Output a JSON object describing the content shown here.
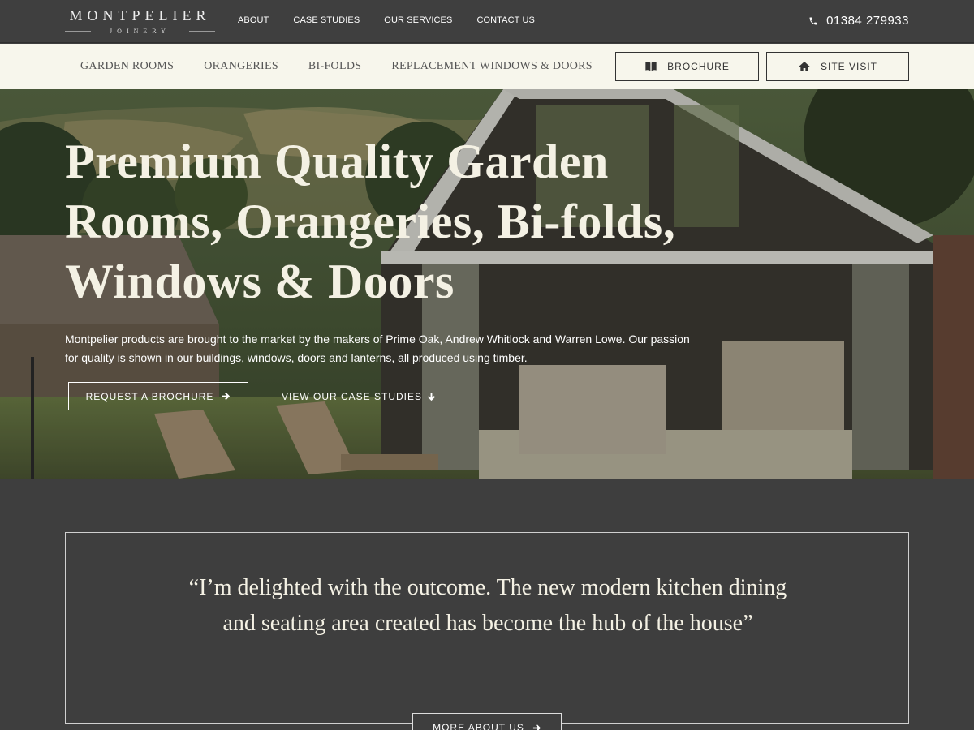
{
  "brand": {
    "name": "MONTPELIER",
    "sub": "JOINERY"
  },
  "topnav": {
    "items": [
      {
        "label": "ABOUT"
      },
      {
        "label": "CASE STUDIES"
      },
      {
        "label": "OUR SERVICES"
      },
      {
        "label": "CONTACT US"
      }
    ],
    "phone": "01384 279933",
    "phone_icon": "phone-icon"
  },
  "subnav": {
    "items": [
      {
        "label": "GARDEN ROOMS"
      },
      {
        "label": "ORANGERIES"
      },
      {
        "label": "BI-FOLDS"
      },
      {
        "label": "REPLACEMENT WINDOWS & DOORS"
      }
    ],
    "brochure_label": "BROCHURE",
    "brochure_icon": "book-icon",
    "visit_label": "SITE VISIT",
    "visit_icon": "home-icon"
  },
  "hero": {
    "title": "Premium Quality Garden Rooms, Orangeries, Bi-folds, Windows & Doors",
    "text": "Montpelier products are brought to the market by the makers of Prime Oak, Andrew Whitlock and Warren Lowe. Our passion for quality is shown in our buildings, windows, doors and lanterns, all produced using timber.",
    "cta_primary": "REQUEST A BROCHURE",
    "cta_secondary": "VIEW OUR CASE STUDIES"
  },
  "testimonial": {
    "quote": "“I’m delighted with the outcome. The new modern kitchen dining and seating area created has become the hub of the house”",
    "button": "MORE ABOUT US"
  },
  "colors": {
    "dark": "#3e3e3e",
    "cream": "#f7f6ec",
    "hero_text": "#f4f1e4"
  }
}
